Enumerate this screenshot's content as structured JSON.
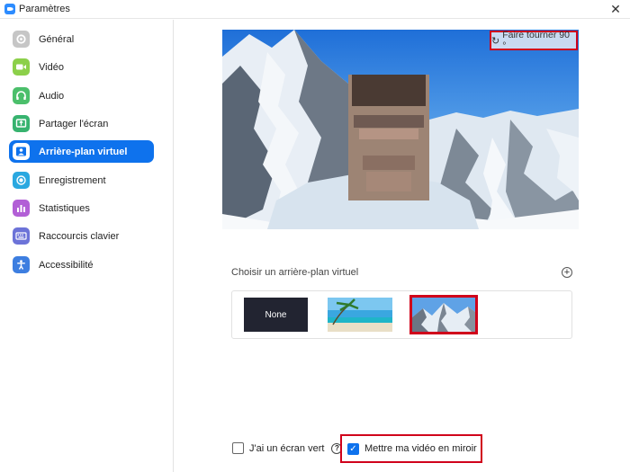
{
  "window": {
    "title": "Paramètres",
    "close_glyph": "✕"
  },
  "sidebar": {
    "items": [
      {
        "label": "Général",
        "icon": "gear-icon",
        "color": "#c9c9c9",
        "active": false
      },
      {
        "label": "Vidéo",
        "icon": "video-camera-icon",
        "color": "#8cd04a",
        "active": false
      },
      {
        "label": "Audio",
        "icon": "headphones-icon",
        "color": "#4bbf6b",
        "active": false
      },
      {
        "label": "Partager l'écran",
        "icon": "share-screen-icon",
        "color": "#37b36f",
        "active": false
      },
      {
        "label": "Arrière-plan virtuel",
        "icon": "person-background-icon",
        "color": "#ffffff",
        "active": true
      },
      {
        "label": "Enregistrement",
        "icon": "record-icon",
        "color": "#2aa8e0",
        "active": false
      },
      {
        "label": "Statistiques",
        "icon": "bar-chart-icon",
        "color": "#b25fd6",
        "active": false
      },
      {
        "label": "Raccourcis clavier",
        "icon": "keyboard-icon",
        "color": "#6c73d8",
        "active": false
      },
      {
        "label": "Accessibilité",
        "icon": "accessibility-icon",
        "color": "#3d7ee0",
        "active": false
      }
    ]
  },
  "main": {
    "rotate_label": "Faire tourner 90 °",
    "choose_label": "Choisir un arrière-plan virtuel",
    "add_glyph": "+",
    "backgrounds": [
      {
        "label": "None",
        "selected": false
      },
      {
        "label": "",
        "selected": false
      },
      {
        "label": "",
        "selected": true
      }
    ],
    "green_screen_label": "J'ai un écran vert",
    "green_screen_checked": false,
    "help_glyph": "?",
    "mirror_label": "Mettre ma vidéo en miroir",
    "mirror_checked": true
  },
  "colors": {
    "accent": "#0e72ed",
    "highlight": "#d0021b"
  }
}
